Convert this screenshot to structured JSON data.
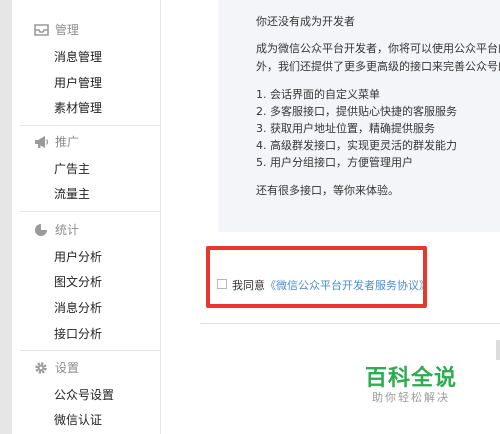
{
  "sidebar": {
    "sections": [
      {
        "title": "管理",
        "icon": "inbox-icon",
        "items": [
          "消息管理",
          "用户管理",
          "素材管理"
        ]
      },
      {
        "title": "推广",
        "icon": "megaphone-icon",
        "items": [
          "广告主",
          "流量主"
        ]
      },
      {
        "title": "统计",
        "icon": "pie-chart-icon",
        "items": [
          "用户分析",
          "图文分析",
          "消息分析",
          "接口分析"
        ]
      },
      {
        "title": "设置",
        "icon": "gear-icon",
        "items": [
          "公众号设置",
          "微信认证"
        ]
      }
    ]
  },
  "main": {
    "heading": "你还没有成为开发者",
    "intro_line1": "成为微信公众平台开发者，你将可以使用公众平台的",
    "intro_line2": "外，我们还提供了更多更高级的接口来完善公众号的",
    "features": [
      "1. 会话界面的自定义菜单",
      "2. 多客服接口，提供贴心快捷的客服服务",
      "3. 获取用户地址位置，精确提供服务",
      "4. 高级群发接口，实现更灵活的群发能力",
      "5. 用户分组接口，方便管理用户"
    ],
    "footer_note": "还有很多接口，等你来体验。"
  },
  "agreement": {
    "prefix": "我同意",
    "link_text": "《微信公众平台开发者服务协议》",
    "checked": false
  },
  "watermark": {
    "title": "百科全说",
    "subtitle": "助你轻松解决"
  },
  "colors": {
    "accent_red": "#e8372b",
    "link_blue": "#4e8ec8",
    "watermark_green": "#2eaa51"
  }
}
